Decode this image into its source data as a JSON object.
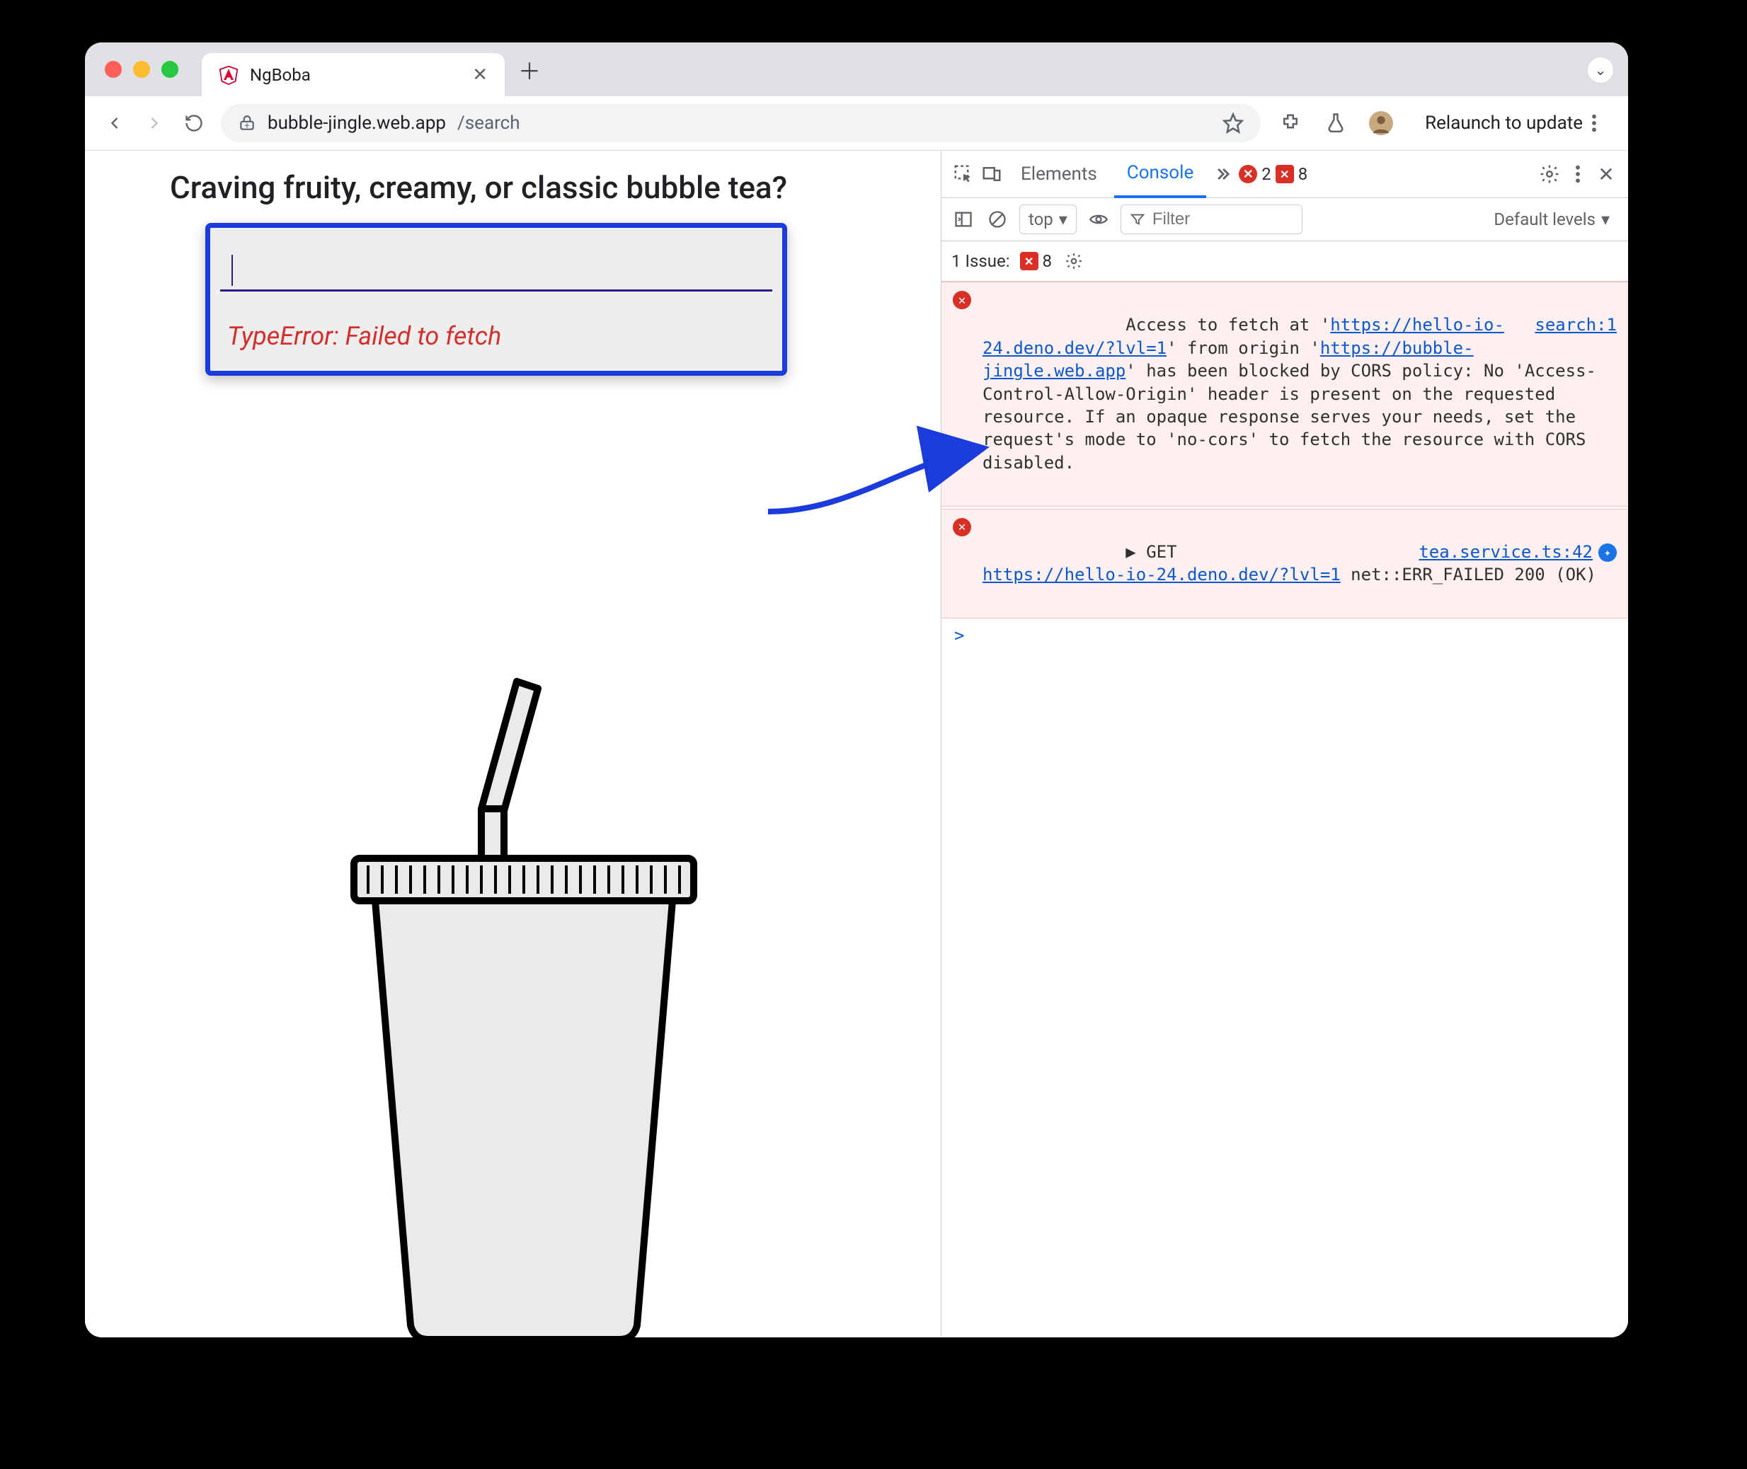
{
  "browser": {
    "tab_title": "NgBoba",
    "url_domain": "bubble-jingle.web.app",
    "url_path": "/search",
    "relaunch_label": "Relaunch to update"
  },
  "page": {
    "headline": "Craving fruity, creamy, or classic bubble tea?",
    "error_text": "TypeError: Failed to fetch"
  },
  "devtools": {
    "tabs": {
      "elements": "Elements",
      "console": "Console"
    },
    "error_count": "2",
    "issues_count": "8",
    "context_label": "top",
    "filter_placeholder": "Filter",
    "levels_label": "Default levels",
    "issues_line_label": "1 Issue:",
    "issues_line_count": "8",
    "msg1": {
      "source": "search:1",
      "pre1": "Access to fetch at '",
      "url1": "https://hello-io-24.deno.dev/?lvl=1",
      "mid1": "' from origin '",
      "url2": "https://bubble-jingle.web.app",
      "post1": "' has been blocked by CORS policy: No 'Access-Control-Allow-Origin' header is present on the requested resource. If an opaque response serves your needs, set the request's mode to 'no-cors' to fetch the resource with CORS disabled."
    },
    "msg2": {
      "source": "tea.service.ts:42",
      "arrow": "▶",
      "label": "GET",
      "url": "https://hello-io-24.deno.dev/?lvl=1",
      "tail": " net::ERR_FAILED 200 (OK)"
    },
    "prompt": ">"
  }
}
